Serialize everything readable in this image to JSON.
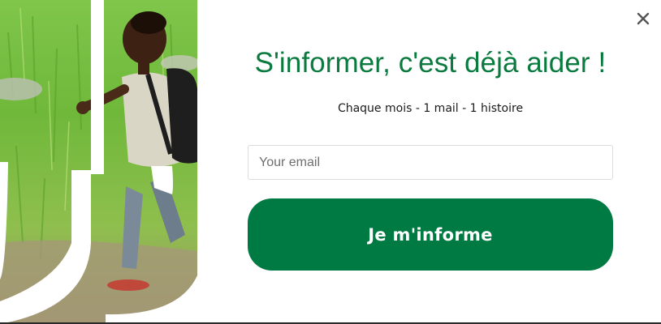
{
  "popup": {
    "title": "S'informer, c'est déjà aider !",
    "subtitle": "Chaque mois - 1 mail - 1 histoire",
    "email_placeholder": "Your email",
    "email_value": "",
    "submit_label": "Je m'informe",
    "close_icon": "close-icon",
    "hero_image": "child-running-in-grass-photo",
    "colors": {
      "accent": "#007a43",
      "title": "#0b7a3f",
      "close": "#555555"
    }
  }
}
